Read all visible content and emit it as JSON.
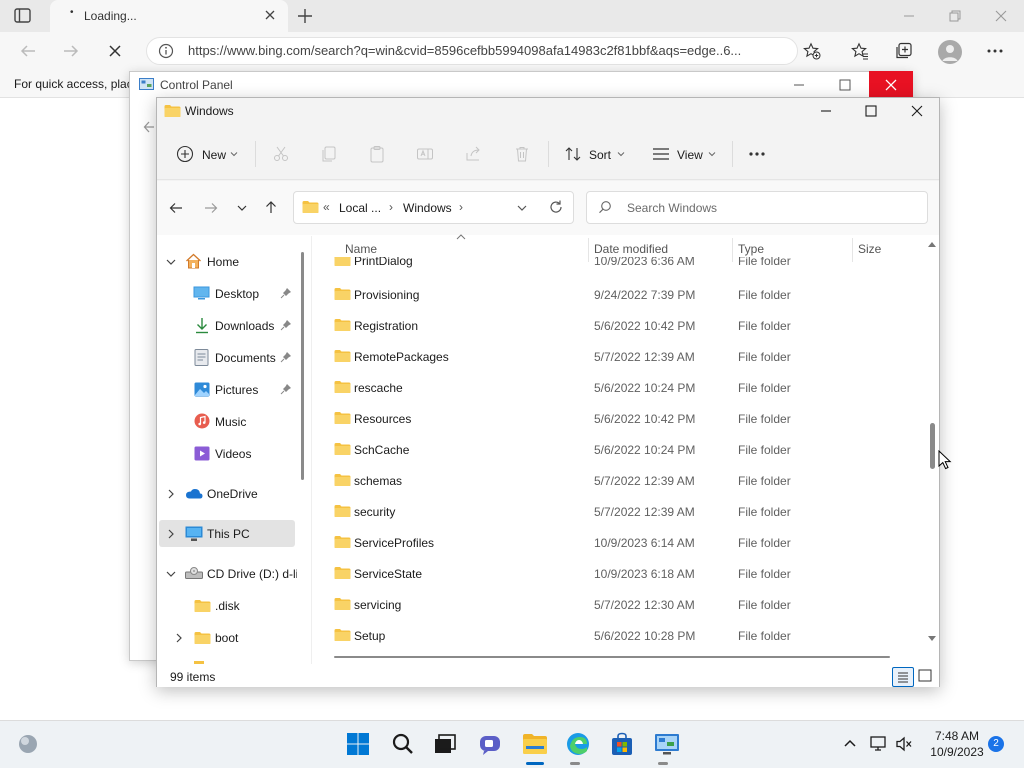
{
  "browser": {
    "tab_title": "Loading...",
    "tab_dot": "•",
    "url": "https://www.bing.com/search?q=win&cvid=8596cefbb5994098afa14983c2f81bbf&aqs=edge..6...",
    "favorites_hint": "For quick access, plac"
  },
  "control_panel": {
    "title": "Control Panel"
  },
  "explorer": {
    "title": "Windows",
    "toolbar": {
      "new_label": "New",
      "sort_label": "Sort",
      "view_label": "View",
      "more_label": "···"
    },
    "address": {
      "prefix": "«",
      "crumbs": [
        "Local ...",
        "Windows"
      ],
      "separator": "›"
    },
    "search_placeholder": "Search Windows",
    "nav": {
      "home": "Home",
      "desktop": "Desktop",
      "downloads": "Downloads",
      "documents": "Documents",
      "pictures": "Pictures",
      "music": "Music",
      "videos": "Videos",
      "onedrive": "OneDrive",
      "thispc": "This PC",
      "cddrive": "CD Drive (D:) d-li",
      "disk": ".disk",
      "boot": "boot"
    },
    "columns": {
      "name": "Name",
      "date": "Date modified",
      "type": "Type",
      "size": "Size"
    },
    "rows": [
      {
        "name": "PrintDialog",
        "date": "10/9/2023 6:36 AM",
        "type": "File folder"
      },
      {
        "name": "Provisioning",
        "date": "9/24/2022 7:39 PM",
        "type": "File folder"
      },
      {
        "name": "Registration",
        "date": "5/6/2022 10:42 PM",
        "type": "File folder"
      },
      {
        "name": "RemotePackages",
        "date": "5/7/2022 12:39 AM",
        "type": "File folder"
      },
      {
        "name": "rescache",
        "date": "5/6/2022 10:24 PM",
        "type": "File folder"
      },
      {
        "name": "Resources",
        "date": "5/6/2022 10:42 PM",
        "type": "File folder"
      },
      {
        "name": "SchCache",
        "date": "5/6/2022 10:24 PM",
        "type": "File folder"
      },
      {
        "name": "schemas",
        "date": "5/7/2022 12:39 AM",
        "type": "File folder"
      },
      {
        "name": "security",
        "date": "5/7/2022 12:39 AM",
        "type": "File folder"
      },
      {
        "name": "ServiceProfiles",
        "date": "10/9/2023 6:14 AM",
        "type": "File folder"
      },
      {
        "name": "ServiceState",
        "date": "10/9/2023 6:18 AM",
        "type": "File folder"
      },
      {
        "name": "servicing",
        "date": "5/7/2022 12:30 AM",
        "type": "File folder"
      },
      {
        "name": "Setup",
        "date": "5/6/2022 10:28 PM",
        "type": "File folder"
      }
    ],
    "status": "99 items"
  },
  "taskbar": {
    "time": "7:48 AM",
    "date": "10/9/2023",
    "notifications": "2"
  },
  "colors": {
    "folder": "#f5c242",
    "accent": "#0067c0",
    "close_red": "#e81123"
  }
}
